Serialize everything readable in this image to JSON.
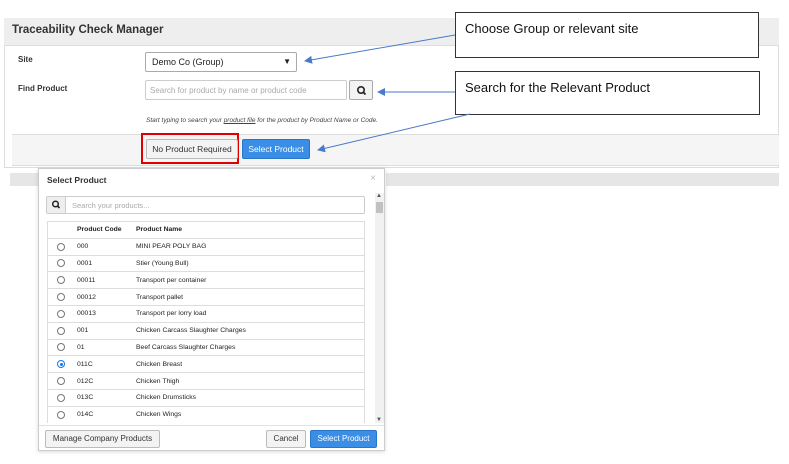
{
  "page": {
    "title": "Traceability Check Manager",
    "site_label": "Site",
    "site_value": "Demo Co (Group)",
    "find_label": "Find Product",
    "find_placeholder": "Search for product by name or product code",
    "helper_prefix": "Start typing to search your ",
    "helper_link": "product file",
    "helper_suffix": " for the product by Product Name or Code.",
    "no_product_label": "No Product Required",
    "select_product_label": "Select Product"
  },
  "callouts": {
    "site": "Choose Group or relevant site",
    "search": "Search for the Relevant Product"
  },
  "modal": {
    "title": "Select Product",
    "close": "×",
    "search_placeholder": "Search your products...",
    "columns": {
      "code": "Product Code",
      "name": "Product Name"
    },
    "rows": [
      {
        "code": "000",
        "name": "MINI PEAR POLY BAG",
        "selected": false
      },
      {
        "code": "0001",
        "name": "Stier (Young Bull)",
        "selected": false
      },
      {
        "code": "00011",
        "name": "Transport per container",
        "selected": false
      },
      {
        "code": "00012",
        "name": "Transport pallet",
        "selected": false
      },
      {
        "code": "00013",
        "name": "Transport per lorry load",
        "selected": false
      },
      {
        "code": "001",
        "name": "Chicken Carcass Slaughter Charges",
        "selected": false
      },
      {
        "code": "01",
        "name": "Beef Carcass Slaughter Charges",
        "selected": false
      },
      {
        "code": "011C",
        "name": "Chicken Breast",
        "selected": true
      },
      {
        "code": "012C",
        "name": "Chicken Thigh",
        "selected": false
      },
      {
        "code": "013C",
        "name": "Chicken Drumsticks",
        "selected": false
      },
      {
        "code": "014C",
        "name": "Chicken Wings",
        "selected": false
      }
    ],
    "manage_label": "Manage Company Products",
    "cancel_label": "Cancel",
    "select_label": "Select Product"
  },
  "colors": {
    "primary": "#3a8ee6",
    "highlight": "#e00000",
    "arrow": "#4a7ac8"
  },
  "icons": {
    "search": "search-icon",
    "close": "close-icon",
    "dropdown": "chevron-down-icon"
  }
}
